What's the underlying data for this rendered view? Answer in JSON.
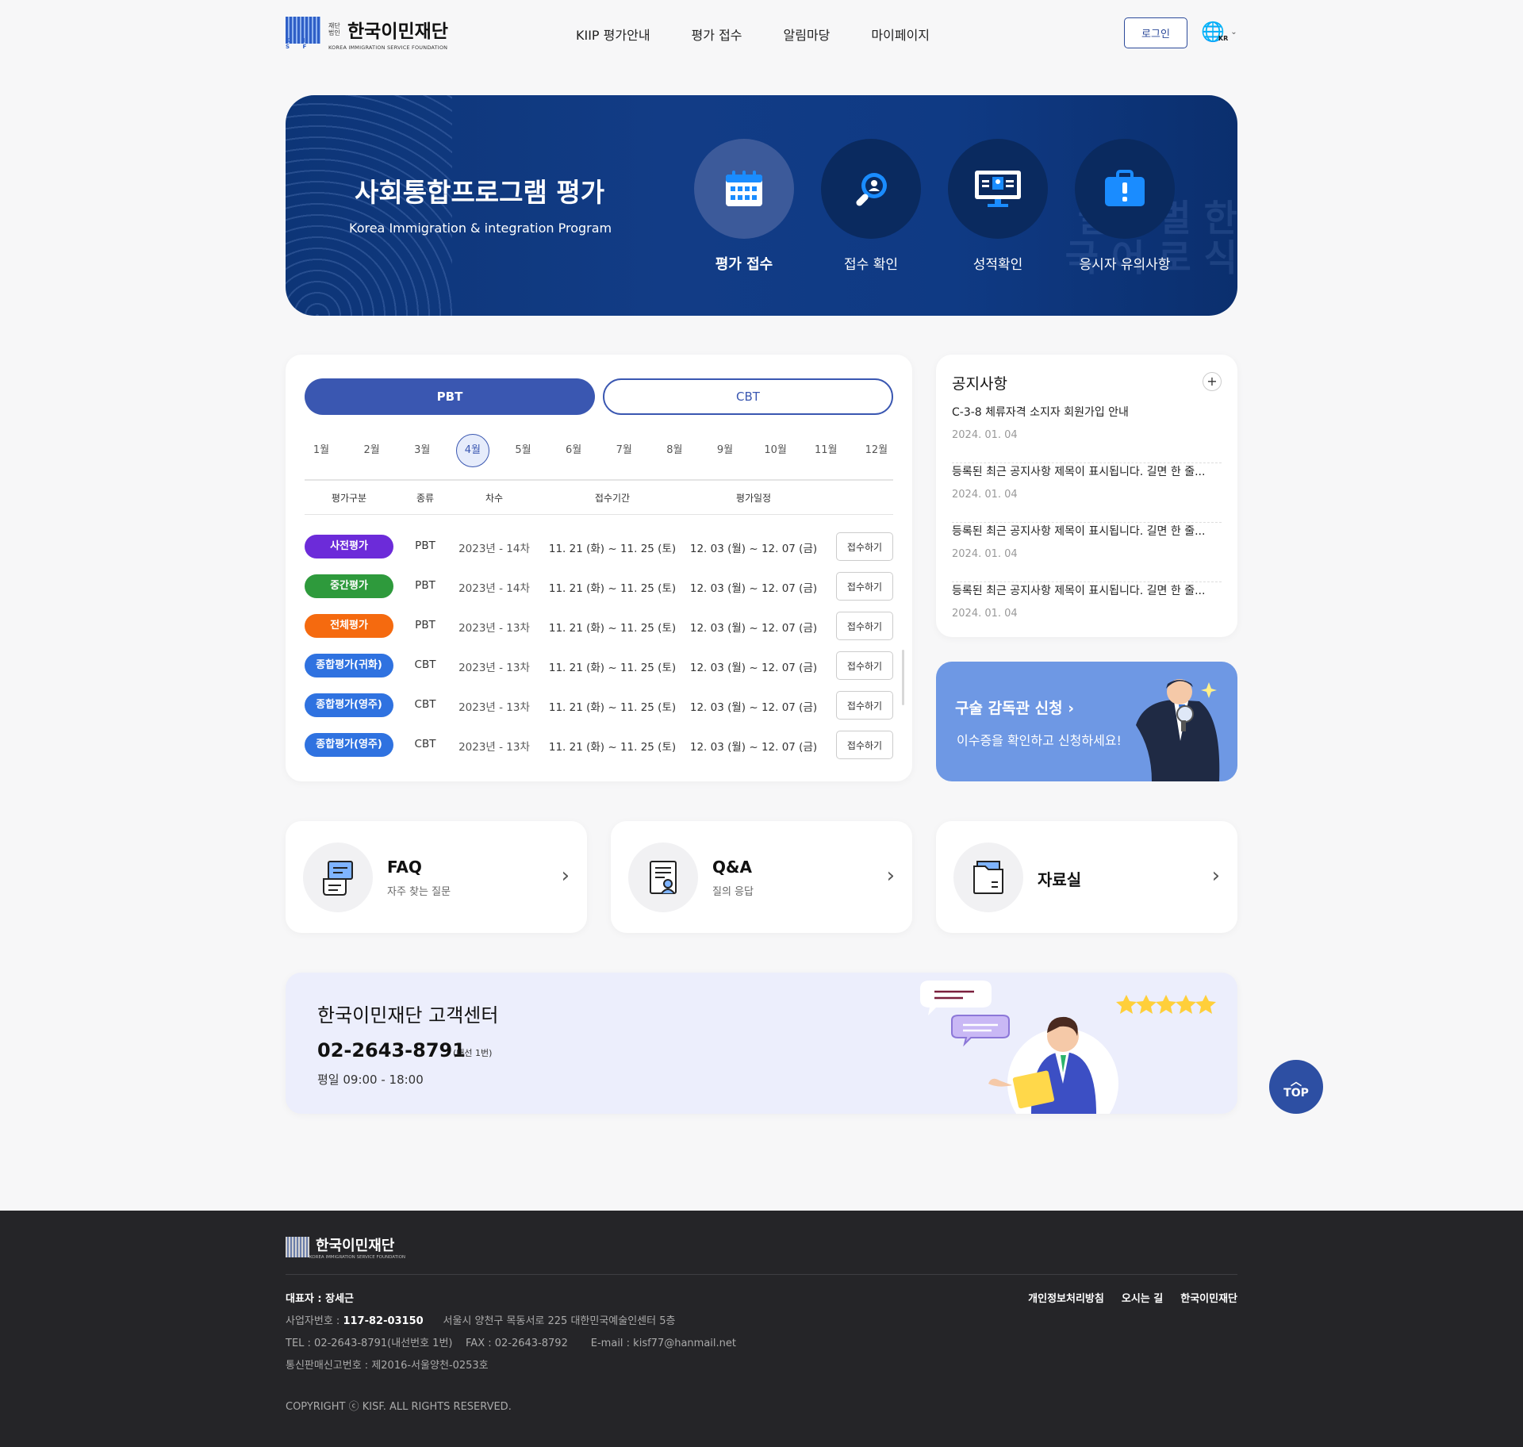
{
  "header": {
    "logo_small": "재단법인",
    "logo_name": "한국이민재단",
    "logo_eng": "KOREA IMMIGRATION SERVICE FOUNDATION",
    "logo_mark": "K I S F",
    "nav": [
      "KIIP 평가안내",
      "평가 접수",
      "알림마당",
      "마이페이지"
    ],
    "login": "로그인",
    "lang": "KR"
  },
  "hero": {
    "title": "사회통합프로그램 평가",
    "subtitle": "Korea Immigration & integration Program",
    "items": [
      {
        "label": "평가 접수",
        "icon": "calendar-icon"
      },
      {
        "label": "접수 확인",
        "icon": "search-person-icon"
      },
      {
        "label": "성적확인",
        "icon": "monitor-icon"
      },
      {
        "label": "응시자 유의사항",
        "icon": "warning-briefcase-icon"
      }
    ],
    "accent": "#0f3a84"
  },
  "schedule": {
    "tabs": {
      "pbt": "PBT",
      "cbt": "CBT"
    },
    "months": [
      "1월",
      "2월",
      "3월",
      "4월",
      "5월",
      "6월",
      "7월",
      "8월",
      "9월",
      "10월",
      "11월",
      "12월"
    ],
    "selected_month": "4월",
    "headers": [
      "평가구분",
      "종류",
      "차수",
      "접수기간",
      "평가일정"
    ],
    "rows": [
      {
        "badge": "사전평가",
        "color": "#6c2bd9",
        "type": "PBT",
        "round": "2023년 - 14차",
        "period": "11. 21 (화) ~ 11. 25 (토)",
        "date": "12. 03 (월) ~ 12. 07 (금)",
        "action": "접수하기"
      },
      {
        "badge": "중간평가",
        "color": "#2e9a3c",
        "type": "PBT",
        "round": "2023년 - 14차",
        "period": "11. 21 (화) ~ 11. 25 (토)",
        "date": "12. 03 (월) ~ 12. 07 (금)",
        "action": "접수하기"
      },
      {
        "badge": "전체평가",
        "color": "#f56a0f",
        "type": "PBT",
        "round": "2023년 - 13차",
        "period": "11. 21 (화) ~ 11. 25 (토)",
        "date": "12. 03 (월) ~ 12. 07 (금)",
        "action": "접수하기"
      },
      {
        "badge": "종합평가(귀화)",
        "color": "#2f72e0",
        "type": "CBT",
        "round": "2023년 - 13차",
        "period": "11. 21 (화) ~ 11. 25 (토)",
        "date": "12. 03 (월) ~ 12. 07 (금)",
        "action": "접수하기"
      },
      {
        "badge": "종합평가(영주)",
        "color": "#2f72e0",
        "type": "CBT",
        "round": "2023년 - 13차",
        "period": "11. 21 (화) ~ 11. 25 (토)",
        "date": "12. 03 (월) ~ 12. 07 (금)",
        "action": "접수하기"
      },
      {
        "badge": "종합평가(영주)",
        "color": "#2f72e0",
        "type": "CBT",
        "round": "2023년 - 13차",
        "period": "11. 21 (화) ~ 11. 25 (토)",
        "date": "12. 03 (월) ~ 12. 07 (금)",
        "action": "접수하기"
      }
    ]
  },
  "notices": {
    "title": "공지사항",
    "more": "+",
    "items": [
      {
        "title": "C-3-8 체류자격 소지자 회원가입 안내",
        "date": "2024. 01. 04"
      },
      {
        "title": "등록된 최근 공지사항 제목이 표시됩니다. 길면 한 줄...",
        "date": "2024. 01. 04"
      },
      {
        "title": "등록된 최근 공지사항 제목이 표시됩니다. 길면 한 줄...",
        "date": "2024. 01. 04"
      },
      {
        "title": "등록된 최근 공지사항 제목이 표시됩니다. 길면 한 줄...",
        "date": "2024. 01. 04"
      }
    ]
  },
  "oral": {
    "title": "구술 감독관 신청 ›",
    "desc": "이수증을 확인하고 신청하세요!"
  },
  "quick": [
    {
      "title": "FAQ",
      "sub": "자주 찾는 질문",
      "icon": "faq-icon"
    },
    {
      "title": "Q&A",
      "sub": "질의 응답",
      "icon": "qna-icon"
    },
    {
      "title": "자료실",
      "sub": "",
      "icon": "folder-icon"
    }
  ],
  "callcenter": {
    "title": "한국이민재단 고객센터",
    "phone": "02-2643-8791",
    "ext": "(내선 1번)",
    "hours": "평일 09:00 - 18:00"
  },
  "top_button": "TOP",
  "footer": {
    "logo_name": "한국이민재단",
    "links": [
      "개인정보처리방침",
      "오시는 길",
      "한국이민재단"
    ],
    "ceo_label": "대표자 : 장세근",
    "biz_label": "사업자번호 :",
    "biz_no": "117-82-03150",
    "address": "서울시 양천구 목동서로 225 대한민국예술인센터 5층",
    "tel": "TEL : 02-2643-8791(내선번호 1번)",
    "fax": "FAX : 02-2643-8792",
    "email": "E-mail : kisf77@hanmail.net",
    "mail_order": "통신판매신고번호 : 제2016-서울양천-0253호",
    "copyright": "COPYRIGHT ⓒ KISF. ALL RIGHTS RESERVED."
  }
}
